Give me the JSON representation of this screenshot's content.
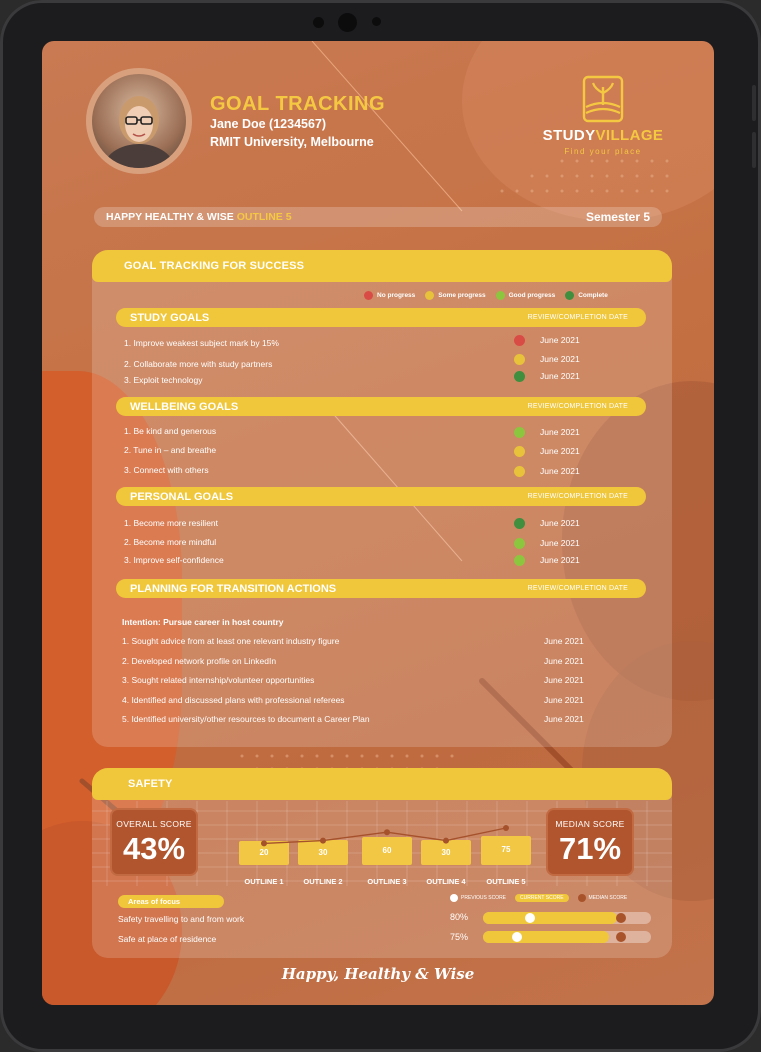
{
  "header": {
    "title": "GOAL TRACKING",
    "student": "Jane Doe (1234567)",
    "university": "RMIT University, Melbourne",
    "logo": {
      "name": "STUDY",
      "name_hl": "VILLAGE",
      "tagline": "Find your place"
    }
  },
  "outline_bar": {
    "prefix": "HAPPY HEALTHY & WISE",
    "outline": "OUTLINE 5",
    "semester": "Semester 5"
  },
  "goal_panel": {
    "title": "GOAL TRACKING FOR SUCCESS",
    "legend": [
      {
        "label": "No progress",
        "color": "#d94c46"
      },
      {
        "label": "Some progress",
        "color": "#e8c23a"
      },
      {
        "label": "Good progress",
        "color": "#8cc63f"
      },
      {
        "label": "Complete",
        "color": "#3f8f3f"
      }
    ],
    "review_label": "REVIEW/COMPLETION DATE",
    "sections": [
      {
        "title": "STUDY GOALS",
        "goals": [
          {
            "text": "1. Improve weakest subject mark by 15%",
            "status": "no",
            "date": "June 2021"
          },
          {
            "text": "2. Collaborate more with study partners",
            "status": "some",
            "date": "June 2021"
          },
          {
            "text": "3. Exploit technology",
            "status": "complete",
            "date": "June 2021"
          }
        ]
      },
      {
        "title": "WELLBEING GOALS",
        "goals": [
          {
            "text": "1. Be kind and generous",
            "status": "good",
            "date": "June 2021"
          },
          {
            "text": "2. Tune in – and breathe",
            "status": "some",
            "date": "June 2021"
          },
          {
            "text": "3. Connect with others",
            "status": "some",
            "date": "June 2021"
          }
        ]
      },
      {
        "title": "PERSONAL GOALS",
        "goals": [
          {
            "text": "1. Become more resilient",
            "status": "complete",
            "date": "June 2021"
          },
          {
            "text": "2. Become more mindful",
            "status": "good",
            "date": "June 2021"
          },
          {
            "text": "3. Improve self-confidence",
            "status": "good",
            "date": "June 2021"
          }
        ]
      }
    ],
    "transition": {
      "title": "PLANNING FOR TRANSITION ACTIONS",
      "intention": "Intention: Pursue career in host country",
      "actions": [
        {
          "text": "1. Sought advice from at least one relevant industry figure",
          "date": "June 2021"
        },
        {
          "text": "2. Developed network profile on LinkedIn",
          "date": "June 2021"
        },
        {
          "text": "3. Sought related internship/volunteer opportunities",
          "date": "June 2021"
        },
        {
          "text": "4. Identified and discussed plans with professional referees",
          "date": "June 2021"
        },
        {
          "text": "5. Identified university/other resources to document a Career Plan",
          "date": "June 2021"
        }
      ]
    }
  },
  "safety": {
    "title": "SAFETY",
    "overall_label": "OVERALL SCORE",
    "overall_value": "43%",
    "median_label": "MEDIAN SCORE",
    "median_value": "71%",
    "chart_data": {
      "type": "bar",
      "categories": [
        "OUTLINE 1",
        "OUTLINE 2",
        "OUTLINE 3",
        "OUTLINE 4",
        "OUTLINE 5"
      ],
      "values": [
        20,
        30,
        60,
        30,
        75
      ],
      "line_values": [
        20,
        30,
        60,
        30,
        75
      ]
    },
    "focus": {
      "label": "Areas of focus",
      "legend": {
        "previous": "PREVIOUS SCORE",
        "current": "CURRENT SCORE",
        "median": "MEDIAN SCORE"
      },
      "rows": [
        {
          "text": "Safety travelling to and from work",
          "pct": "80%",
          "current": 0.8,
          "previous": 0.28,
          "median": 0.82
        },
        {
          "text": "Safe at place of residence",
          "pct": "75%",
          "current": 0.75,
          "previous": 0.2,
          "median": 0.82
        }
      ]
    }
  },
  "footer": "Happy, Healthy & Wise",
  "colors": {
    "accent": "#f0c63a",
    "background": "#c47043",
    "dark_orange": "#b0552e"
  }
}
